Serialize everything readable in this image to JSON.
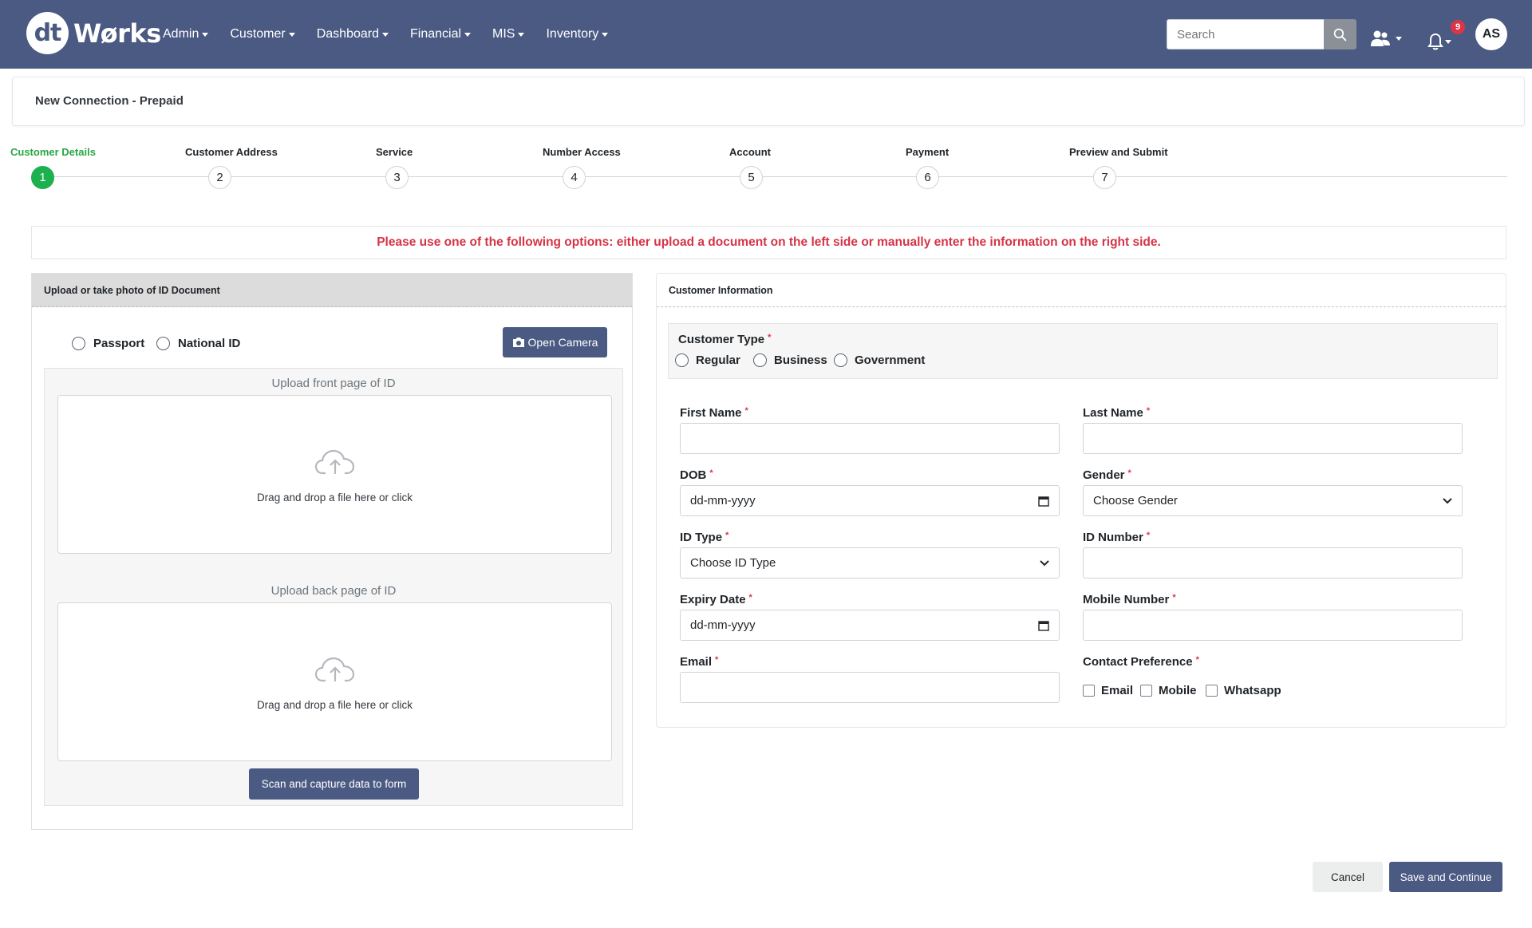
{
  "brand": {
    "logo_mark": "dt",
    "logo_text": "Wørks"
  },
  "nav": {
    "items": [
      {
        "label": "Admin"
      },
      {
        "label": "Customer"
      },
      {
        "label": "Dashboard"
      },
      {
        "label": "Financial"
      },
      {
        "label": "MIS"
      },
      {
        "label": "Inventory"
      }
    ],
    "search_placeholder": "Search",
    "notification_count": "9",
    "avatar_initials": "AS"
  },
  "page": {
    "title": "New Connection - Prepaid"
  },
  "stepper": {
    "steps": [
      {
        "label": "Customer Details",
        "number": "1"
      },
      {
        "label": "Customer Address",
        "number": "2"
      },
      {
        "label": "Service",
        "number": "3"
      },
      {
        "label": "Number Access",
        "number": "4"
      },
      {
        "label": "Account",
        "number": "5"
      },
      {
        "label": "Payment",
        "number": "6"
      },
      {
        "label": "Preview and Submit",
        "number": "7"
      }
    ]
  },
  "alert": {
    "text": "Please use one of the following options: either upload a document on the left side or manually enter the information on the right side."
  },
  "upload": {
    "header": "Upload or take photo of ID Document",
    "doc_types": [
      "Passport",
      "National ID"
    ],
    "open_camera": "Open Camera",
    "front_title": "Upload front page of ID",
    "back_title": "Upload back page of ID",
    "dropzone_text": "Drag and drop a file here or click",
    "scan_button": "Scan and capture data to form"
  },
  "customer": {
    "header": "Customer Information",
    "type_label": "Customer Type",
    "types": [
      "Regular",
      "Business",
      "Government"
    ],
    "required_mark": "*",
    "first_name": "First Name",
    "last_name": "Last Name",
    "dob": "DOB",
    "dob_placeholder": "dd-mm-yyyy",
    "gender": "Gender",
    "gender_value": "Choose Gender",
    "id_type": "ID Type",
    "id_type_value": "Choose ID Type",
    "id_number": "ID Number",
    "expiry": "Expiry Date",
    "expiry_placeholder": "dd-mm-yyyy",
    "mobile": "Mobile Number",
    "email": "Email",
    "contact_pref": "Contact Preference",
    "contact_options": [
      "Email",
      "Mobile",
      "Whatsapp"
    ]
  },
  "actions": {
    "cancel": "Cancel",
    "save": "Save and Continue"
  },
  "colors": {
    "navbar": "#4a5a82",
    "active_step": "#1cb04e",
    "alert_text": "#d63347",
    "primary_button": "#4a5a82"
  }
}
